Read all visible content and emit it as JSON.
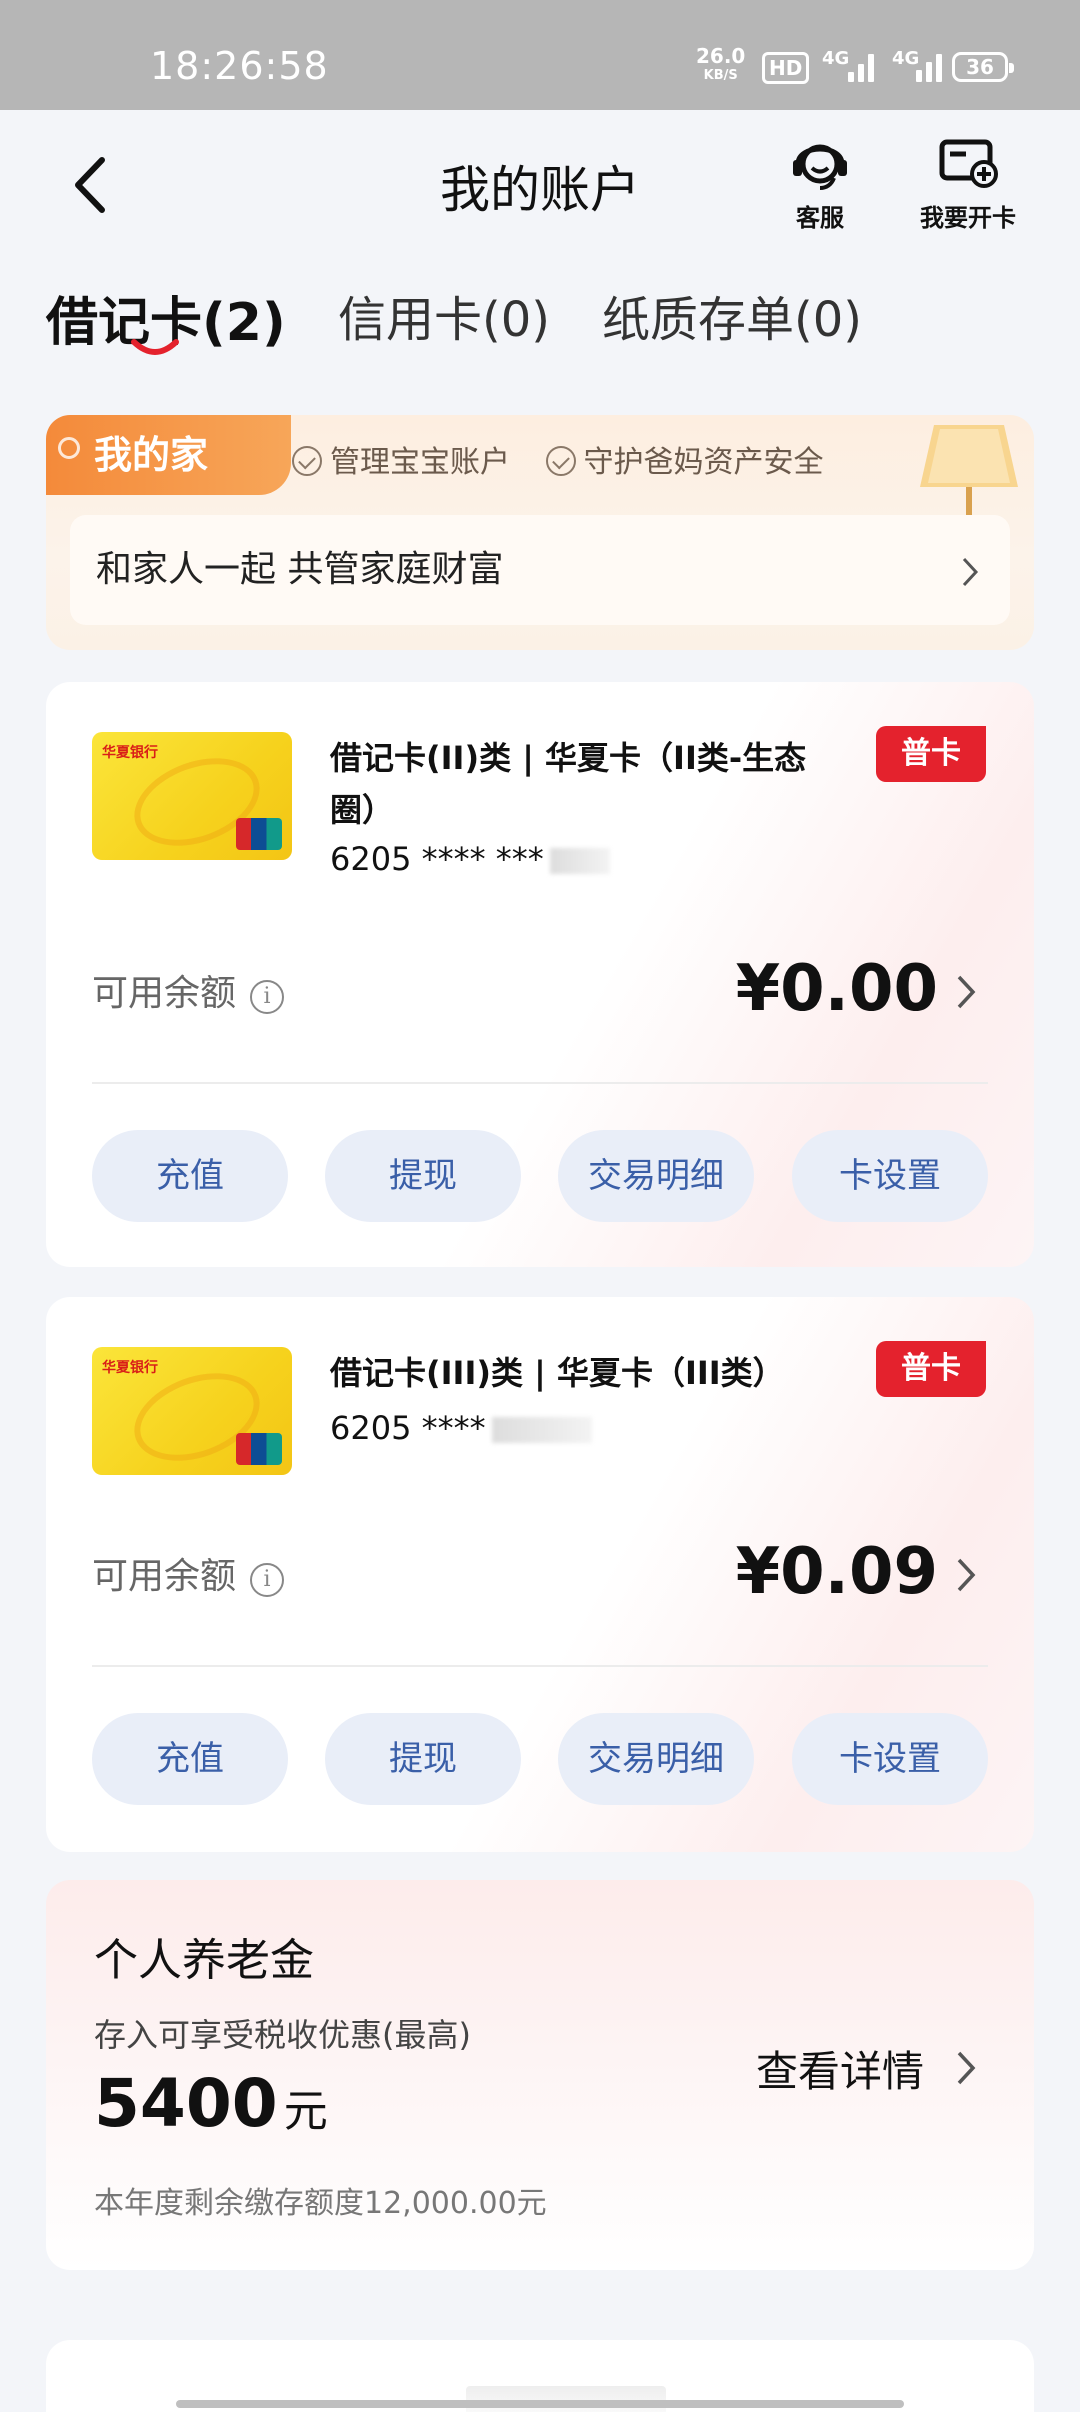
{
  "status_bar": {
    "time": "18:26:58",
    "speed_value": "26.0",
    "speed_unit": "KB/S",
    "hd": "HD",
    "sim1": "4G",
    "sim2": "4G",
    "battery": "36"
  },
  "header": {
    "title": "我的账户",
    "service_label": "客服",
    "open_card_label": "我要开卡"
  },
  "tabs": [
    {
      "label": "借记卡(2)",
      "active": true
    },
    {
      "label": "信用卡(0)",
      "active": false
    },
    {
      "label": "纸质存单(0)",
      "active": false
    }
  ],
  "family": {
    "badge": "我的家",
    "tag1": "管理宝宝账户",
    "tag2": "守护爸妈资产安全",
    "row_text": "和家人一起 共管家庭财富"
  },
  "cards": [
    {
      "name": "借记卡(II)类 | 华夏卡（II类-生态圈）",
      "number": "6205 **** ***",
      "tag": "普卡",
      "balance_label": "可用余额",
      "balance": "¥0.00",
      "bank_logo_text": "华夏银行",
      "actions": [
        "充值",
        "提现",
        "交易明细",
        "卡设置"
      ]
    },
    {
      "name": "借记卡(III)类 | 华夏卡（III类）",
      "number": "6205 ****",
      "tag": "普卡",
      "balance_label": "可用余额",
      "balance": "¥0.09",
      "bank_logo_text": "华夏银行",
      "actions": [
        "充值",
        "提现",
        "交易明细",
        "卡设置"
      ]
    }
  ],
  "pension": {
    "title": "个人养老金",
    "desc": "存入可享受税收优惠(最高)",
    "amount": "5400",
    "unit": "元",
    "limit": "本年度剩余缴存额度12,000.00元",
    "detail": "查看详情"
  },
  "colors": {
    "accent_red": "#e4222d",
    "action_text": "#3a5fa8",
    "action_bg": "#e9eef8",
    "family_orange": "#f48a3a"
  }
}
